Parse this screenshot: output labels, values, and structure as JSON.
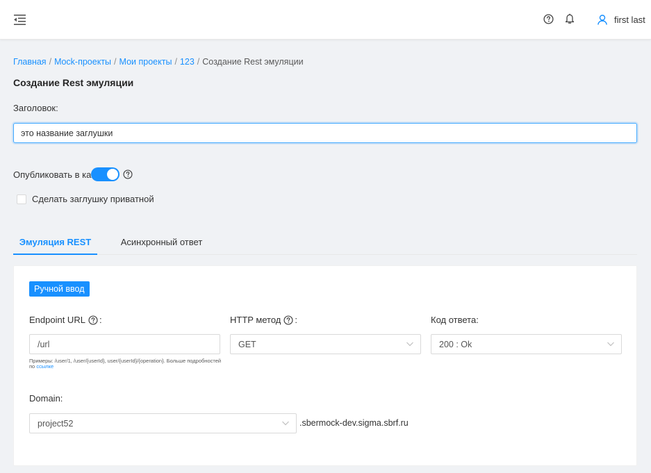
{
  "header": {
    "user_name": "first last"
  },
  "breadcrumb": {
    "items": [
      "Главная",
      "Mock-проекты",
      "Мои проекты",
      "123"
    ],
    "current": "Создание Rest эмуляции",
    "separator": "/"
  },
  "page": {
    "title": "Создание Rest эмуляции"
  },
  "form": {
    "title_label": "Заголовок:",
    "title_value": "это название заглушки",
    "publish_label": "Опубликовать в каталоге",
    "publish_enabled": true,
    "private_label": "Сделать заглушку приватной",
    "private_checked": false
  },
  "tabs": [
    {
      "label": "Эмуляция REST",
      "active": true
    },
    {
      "label": "Асинхронный ответ",
      "active": false
    }
  ],
  "card": {
    "manual_button": "Ручной ввод",
    "endpoint_label": "Endpoint URL",
    "endpoint_value": "/url",
    "method_label": "HTTP метод",
    "method_value": "GET",
    "code_label": "Код ответа:",
    "code_value": "200 : Ok",
    "hint_text": "Примеры: /user/1, /user/{userId}, user/{userId}/{operation}. Больше подробностей по",
    "hint_link": "ссылке",
    "domain_label": "Domain:",
    "domain_value": "project52",
    "domain_suffix": ".sbermock-dev.sigma.sbrf.ru"
  },
  "colors": {
    "accent": "#1890ff",
    "background": "#f0f2f5"
  },
  "icons": [
    "menu-fold-icon",
    "question-circle-icon",
    "bell-icon",
    "user-icon",
    "chevron-down-icon"
  ]
}
